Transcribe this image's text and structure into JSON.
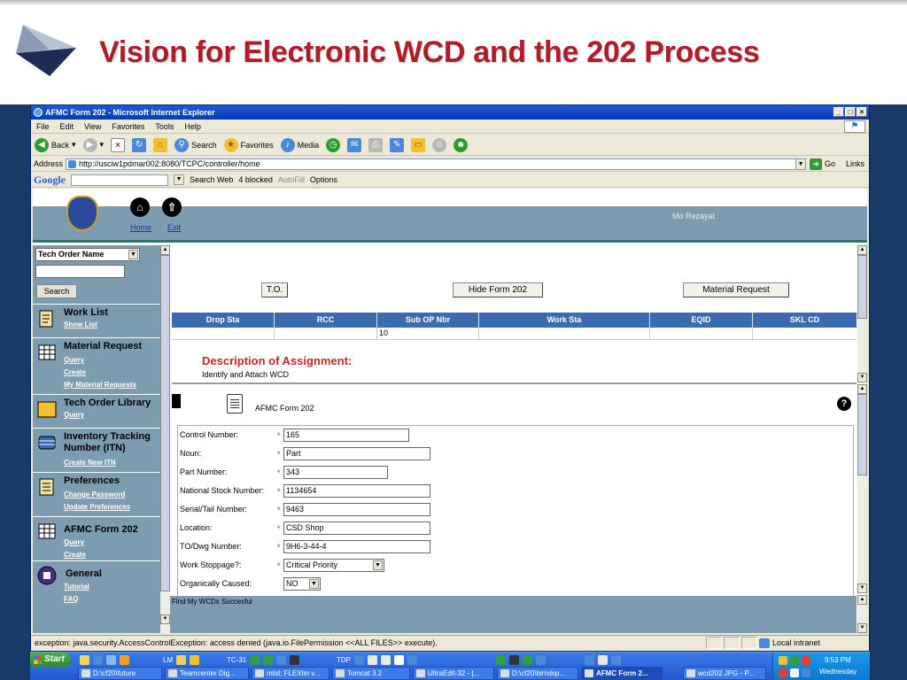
{
  "slide": {
    "title": "Vision for Electronic WCD and the 202 Process"
  },
  "window": {
    "title": "AFMC Form 202 - Microsoft Internet Explorer",
    "controls": [
      "_",
      "□",
      "×"
    ]
  },
  "menubar": [
    "File",
    "Edit",
    "View",
    "Favorites",
    "Tools",
    "Help"
  ],
  "toolbar": {
    "back": "Back",
    "search": "Search",
    "favorites": "Favorites",
    "media": "Media"
  },
  "address": {
    "label": "Address",
    "url": "http://usciw1pdmar002:8080/TCPC/controller/home",
    "go": "Go",
    "links": "Links"
  },
  "google_bar": {
    "logo": "Google",
    "search_web": "Search Web",
    "blocked": "4 blocked",
    "autofill": "AutoFill",
    "options": "Options"
  },
  "app_header": {
    "home": "Home",
    "exit": "Exit",
    "user": "Mo Rezayat"
  },
  "sidebar": {
    "select": "Tech Order Name",
    "search_button": "Search",
    "sections": [
      {
        "title": "Work List",
        "links": [
          "Show List"
        ]
      },
      {
        "title": "Material Request",
        "links": [
          "Query",
          "Create",
          "My Material Requests"
        ]
      },
      {
        "title": "Tech Order Library",
        "links": [
          "Query"
        ]
      },
      {
        "title": "Inventory Tracking Number (ITN)",
        "links": [
          "Create New ITN"
        ]
      },
      {
        "title": "Preferences",
        "links": [
          "Change Password",
          "Update Preferences"
        ]
      },
      {
        "title": "AFMC Form 202",
        "links": [
          "Query",
          "Create"
        ]
      },
      {
        "title": "General",
        "links": [
          "Tutorial",
          "FAQ"
        ]
      }
    ]
  },
  "main": {
    "buttons": {
      "to": "T.O.",
      "hide": "Hide Form 202",
      "material": "Material Request"
    },
    "grid": {
      "headers": [
        "Drop Sta",
        "RCC",
        "Sub OP Nbr",
        "Work Sta",
        "EQID",
        "SKL CD"
      ],
      "row": [
        "",
        "",
        "10",
        "",
        "",
        ""
      ]
    },
    "description": {
      "title": "Description of Assignment:",
      "text": "Identify and Attach WCD"
    },
    "form_name": "AFMC Form 202",
    "help": "?",
    "fields": [
      {
        "label": "Control Number:",
        "value": "165"
      },
      {
        "label": "Noun:",
        "value": "Part"
      },
      {
        "label": "Part Number:",
        "value": "343"
      },
      {
        "label": "National Stock Number:",
        "value": "1134654"
      },
      {
        "label": "Serial/Tail Number:",
        "value": "9463"
      },
      {
        "label": "Location:",
        "value": "CSD Shop"
      },
      {
        "label": "TO/Dwg Number:",
        "value": "9H6-3-44-4"
      },
      {
        "label": "Work Stoppage?:",
        "value": "Critical Priority"
      },
      {
        "label": "Organically Caused:",
        "value": "NO"
      }
    ],
    "required_mark": "*",
    "status": "Find My WCDs Succesful"
  },
  "statusbar": {
    "message": "exception: java.security.AccessControlException: access denied (java.io.FilePermission <<ALL FILES>> execute).",
    "zone": "Local intranet"
  },
  "taskbar": {
    "start": "Start",
    "quick": [
      "LM",
      "TC-31",
      "TDP"
    ],
    "tasks": [
      "D:\\cf20\\future",
      "Teamcenter Dig...",
      "mtid: FLEXlm v...",
      "Tomcat 3.2",
      "UltraEdit-32 - [...",
      "D:\\cf20\\bin\\dsp...",
      "AFMC Form 2...",
      "wcd202.JPG - P..."
    ],
    "time": "9:53 PM",
    "day": "Wednesday"
  },
  "colors": {
    "title_red": "#b01c28",
    "navy": "#183a69",
    "steel": "#7d9cb0",
    "grid_blue": "#3d6bb0"
  }
}
